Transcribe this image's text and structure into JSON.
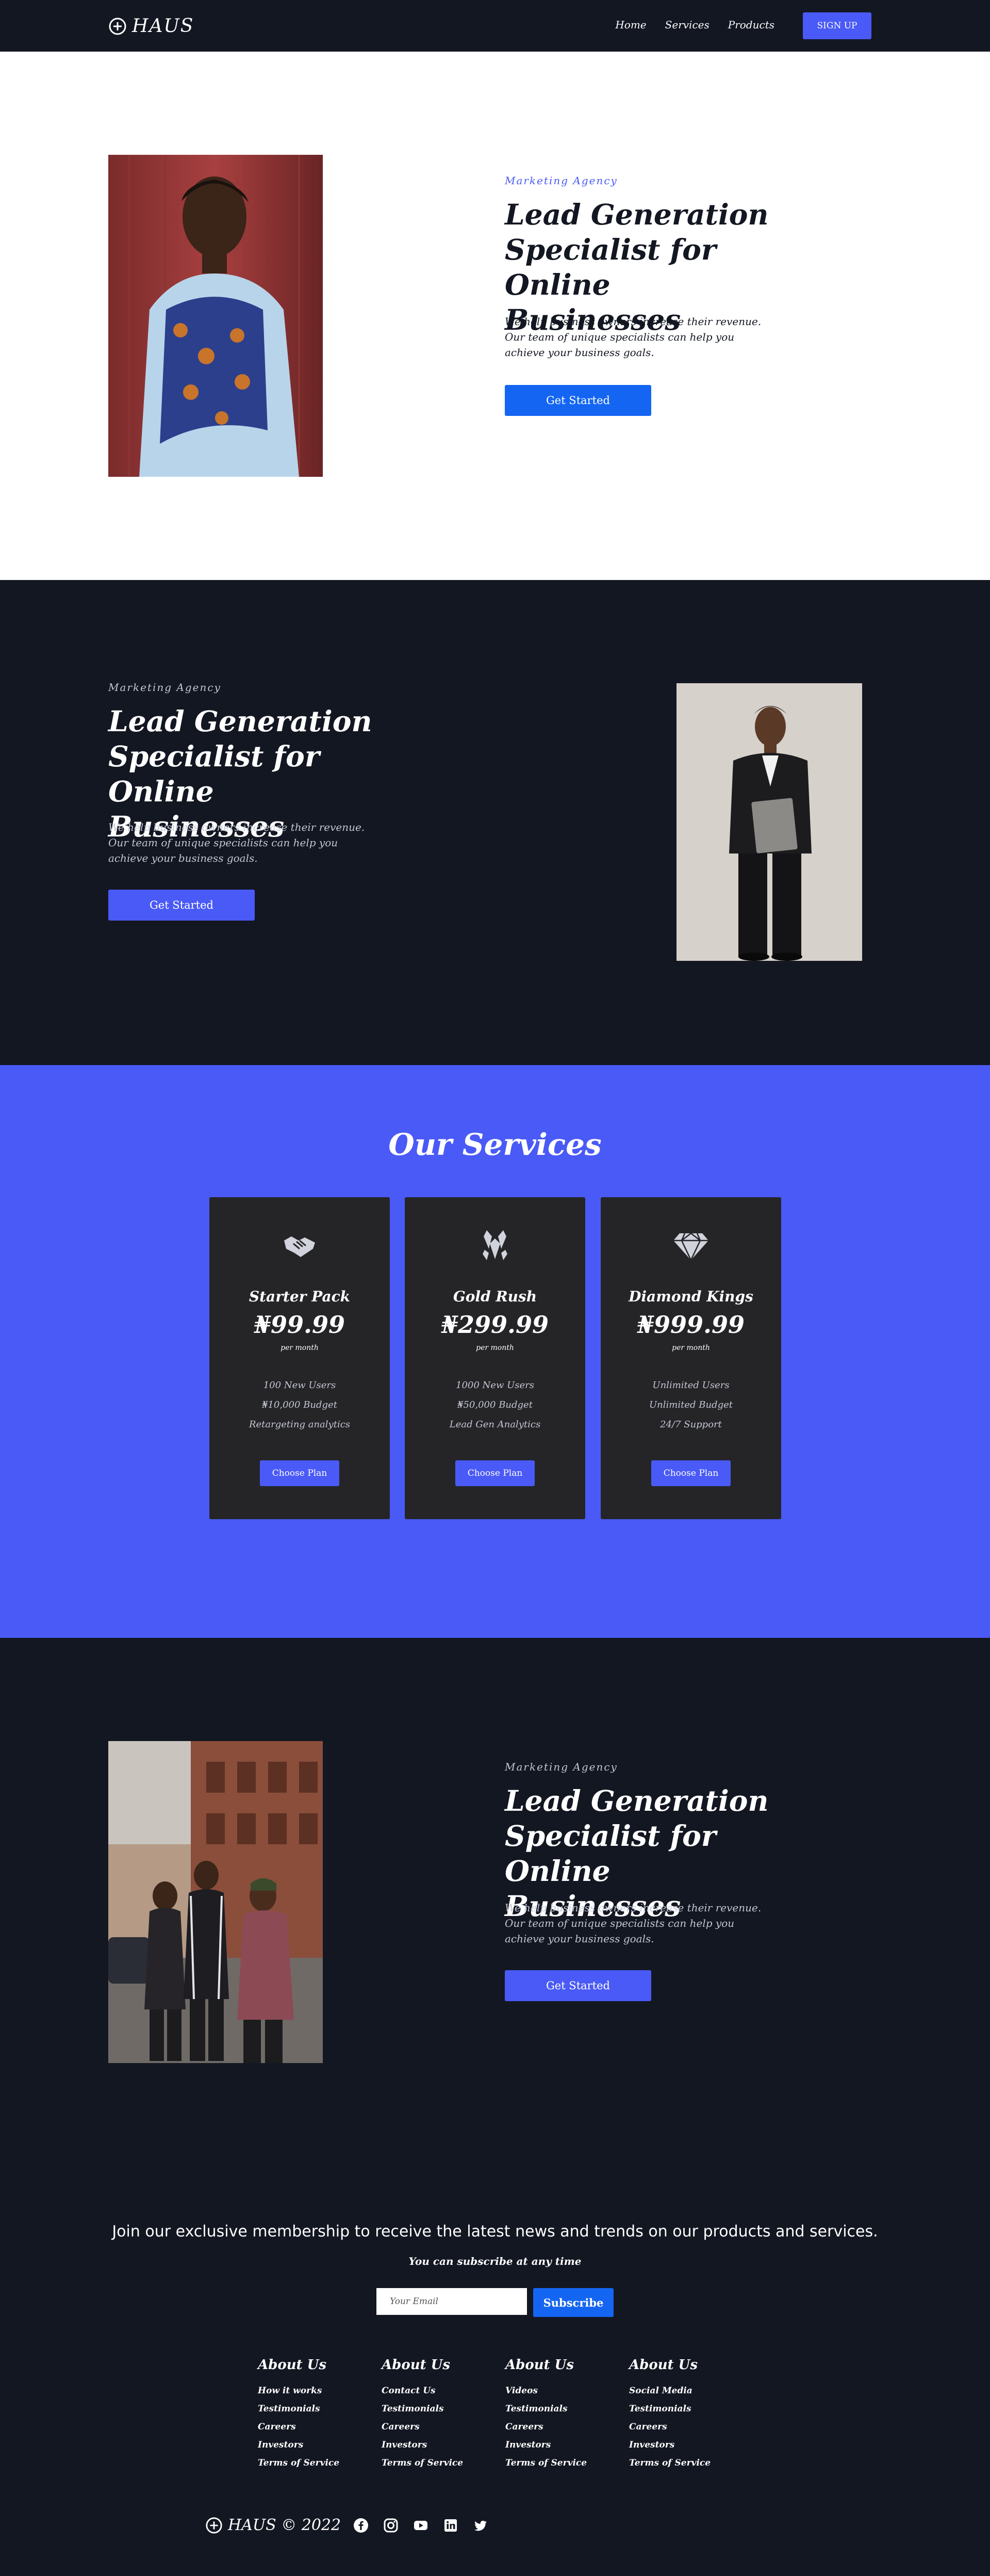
{
  "nav": {
    "logo": "HAUS",
    "links": [
      "Home",
      "Services",
      "Products"
    ],
    "signup": "SIGN UP"
  },
  "colors": {
    "navy": "#131722",
    "accent": "#4a5af6",
    "blue_button": "#1466f2",
    "card": "#252528"
  },
  "hero1": {
    "eyebrow": "Marketing Agency",
    "headline": "Lead Generation Specialist for Online Businesses",
    "blurb": "We help business owners increase their revenue. Our team of unique specialists can help you achieve your business goals.",
    "cta": "Get Started"
  },
  "hero2": {
    "eyebrow": "Marketing Agency",
    "headline": "Lead Generation Specialist for Online Businesses",
    "blurb": "We help business owners increase their revenue. Our team of unique specialists can help you achieve your business goals.",
    "cta": "Get Started"
  },
  "services": {
    "title": "Our Services",
    "plans": [
      {
        "icon": "handshake-icon",
        "name": "Starter Pack",
        "price": "₦99.99",
        "period": "per month",
        "features": [
          "100 New Users",
          "₦10,000 Budget",
          "Retargeting analytics"
        ],
        "button": "Choose Plan"
      },
      {
        "icon": "gem-cluster-icon",
        "name": "Gold Rush",
        "price": "₦299.99",
        "period": "per month",
        "features": [
          "1000 New Users",
          "₦50,000 Budget",
          "Lead Gen Analytics"
        ],
        "button": "Choose Plan"
      },
      {
        "icon": "diamond-icon",
        "name": "Diamond Kings",
        "price": "₦999.99",
        "period": "per month",
        "features": [
          "Unlimited Users",
          "Unlimited Budget",
          "24/7 Support"
        ],
        "button": "Choose Plan"
      }
    ]
  },
  "hero3": {
    "eyebrow": "Marketing Agency",
    "headline": "Lead Generation Specialist for Online Businesses",
    "blurb": "We help business owners increase their revenue. Our team of unique specialists can help you achieve your business goals.",
    "cta": "Get Started"
  },
  "footer": {
    "join": "Join our exclusive membership to receive the latest news and trends on our products and services.",
    "note": "You can subscribe at any time",
    "email_placeholder": "Your Email",
    "subscribe": "Subscribe",
    "columns": [
      {
        "title": "About Us",
        "links": [
          "How it works",
          "Testimonials",
          "Careers",
          "Investors",
          "Terms of Service"
        ]
      },
      {
        "title": "About Us",
        "links": [
          "Contact Us",
          "Testimonials",
          "Careers",
          "Investors",
          "Terms of Service"
        ]
      },
      {
        "title": "About Us",
        "links": [
          "Videos",
          "Testimonials",
          "Careers",
          "Investors",
          "Terms of Service"
        ]
      },
      {
        "title": "About Us",
        "links": [
          "Social Media",
          "Testimonials",
          "Careers",
          "Investors",
          "Terms of Service"
        ]
      }
    ],
    "copyright": "HAUS © 2022",
    "social": [
      "facebook-icon",
      "instagram-icon",
      "youtube-icon",
      "linkedin-icon",
      "twitter-icon"
    ]
  }
}
